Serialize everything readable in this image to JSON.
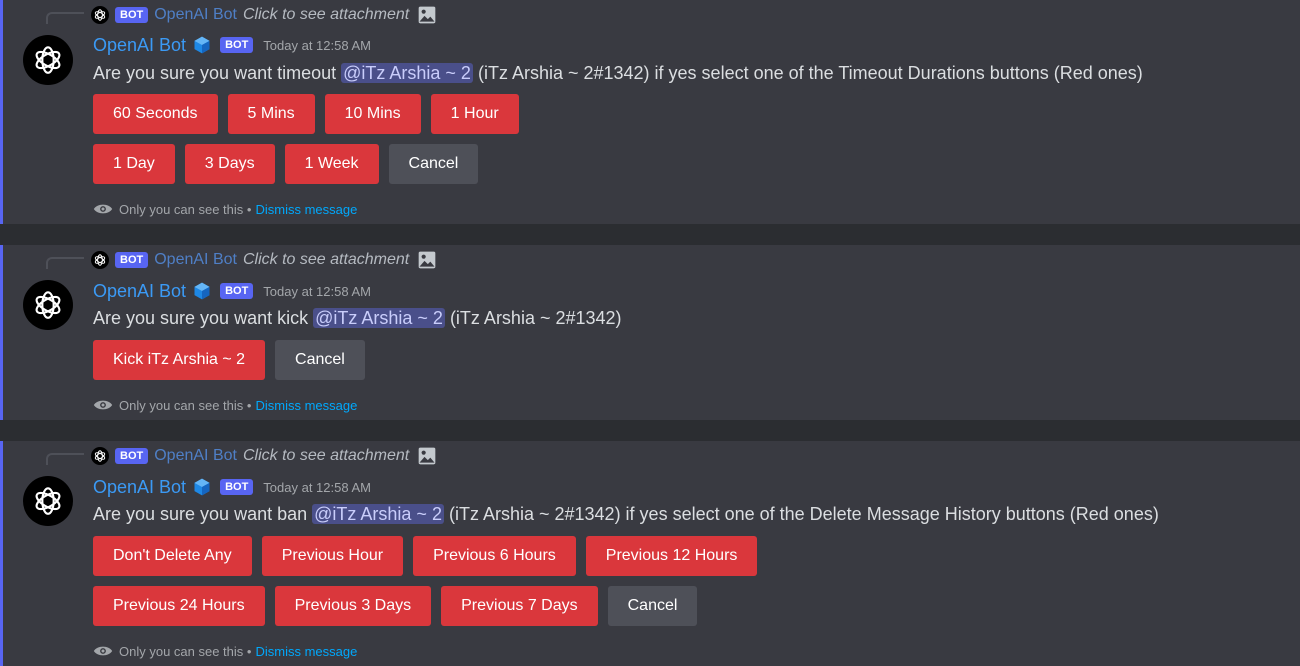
{
  "messages": [
    {
      "reply": {
        "badge": "BOT",
        "name": "OpenAI Bot",
        "text": "Click to see attachment"
      },
      "author": "OpenAI Bot",
      "badge": "BOT",
      "timestamp": "Today at 12:58 AM",
      "content": {
        "before": "Are you sure you want timeout ",
        "mention": "@iTz Arshia ~ 2",
        "after": " (iTz Arshia ~ 2#1342) if yes select one of the Timeout Durations buttons (Red ones)"
      },
      "button_rows": [
        [
          "60 Seconds",
          "5 Mins",
          "10 Mins",
          "1 Hour"
        ],
        [
          "1 Day",
          "3 Days",
          "1 Week",
          "Cancel"
        ]
      ],
      "ephemeral": {
        "text": "Only you can see this",
        "separator": "•",
        "dismiss": "Dismiss message"
      }
    },
    {
      "reply": {
        "badge": "BOT",
        "name": "OpenAI Bot",
        "text": "Click to see attachment"
      },
      "author": "OpenAI Bot",
      "badge": "BOT",
      "timestamp": "Today at 12:58 AM",
      "content": {
        "before": "Are you sure you want kick ",
        "mention": "@iTz Arshia ~ 2",
        "after": " (iTz Arshia ~ 2#1342)"
      },
      "button_rows": [
        [
          "Kick iTz Arshia ~ 2",
          "Cancel"
        ]
      ],
      "ephemeral": {
        "text": "Only you can see this",
        "separator": "•",
        "dismiss": "Dismiss message"
      }
    },
    {
      "reply": {
        "badge": "BOT",
        "name": "OpenAI Bot",
        "text": "Click to see attachment"
      },
      "author": "OpenAI Bot",
      "badge": "BOT",
      "timestamp": "Today at 12:58 AM",
      "content": {
        "before": "Are you sure you want ban ",
        "mention": "@iTz Arshia ~ 2",
        "after": " (iTz Arshia ~ 2#1342) if yes select one of the Delete Message History buttons (Red ones)"
      },
      "button_rows": [
        [
          "Don't Delete Any",
          "Previous Hour",
          "Previous 6 Hours",
          "Previous 12 Hours"
        ],
        [
          "Previous 24 Hours",
          "Previous 3 Days",
          "Previous 7 Days",
          "Cancel"
        ]
      ],
      "ephemeral": {
        "text": "Only you can see this",
        "separator": "•",
        "dismiss": "Dismiss message"
      }
    }
  ],
  "colors": {
    "danger_button": "#da373c",
    "secondary_button": "#4e5058",
    "author_name": "#3b9af5",
    "bot_badge": "#5865f2",
    "mention_bg": "#4a4f8a",
    "link": "#00a8fc"
  },
  "icons": [
    "openai-logo-icon",
    "verified-cube-icon",
    "image-icon",
    "eye-icon"
  ]
}
